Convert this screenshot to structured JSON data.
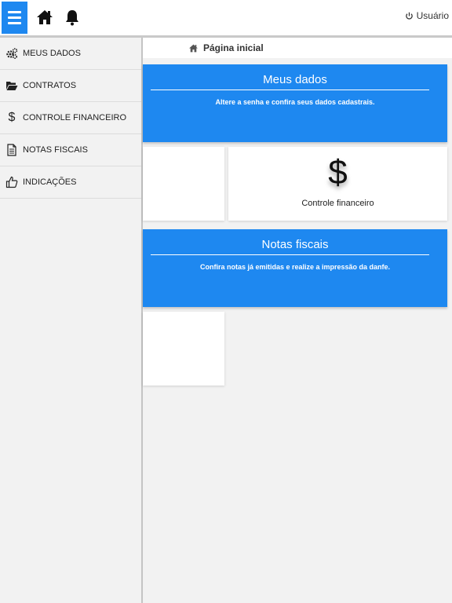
{
  "header": {
    "menu_icon": "hamburger-icon",
    "home_icon": "home-icon",
    "bell_icon": "bell-icon",
    "user_label": "Usuário",
    "user_icon": "power-icon",
    "accent_color": "#1e88f0"
  },
  "sidebar": {
    "items": [
      {
        "label": "MEUS DADOS",
        "icon": "gears-icon"
      },
      {
        "label": "CONTRATOS",
        "icon": "folder-open-icon"
      },
      {
        "label": "CONTROLE FINANCEIRO",
        "icon": "dollar-icon",
        "glyph": "$"
      },
      {
        "label": "NOTAS FISCAIS",
        "icon": "document-icon"
      },
      {
        "label": "INDICAÇÕES",
        "icon": "thumbs-up-icon"
      }
    ]
  },
  "breadcrumb": {
    "label": "Página inicial",
    "icon": "home-icon"
  },
  "sections": {
    "meus_dados": {
      "title": "Meus dados",
      "description": "Altere a senha e confira seus dados cadastrais."
    },
    "notas_fiscais": {
      "title": "Notas fiscais",
      "description": "Confira notas já emitidas e realize a impressão da danfe."
    }
  },
  "cards": {
    "controle_financeiro": {
      "glyph": "$",
      "label": "Controle financeiro",
      "icon": "dollar-icon"
    }
  }
}
